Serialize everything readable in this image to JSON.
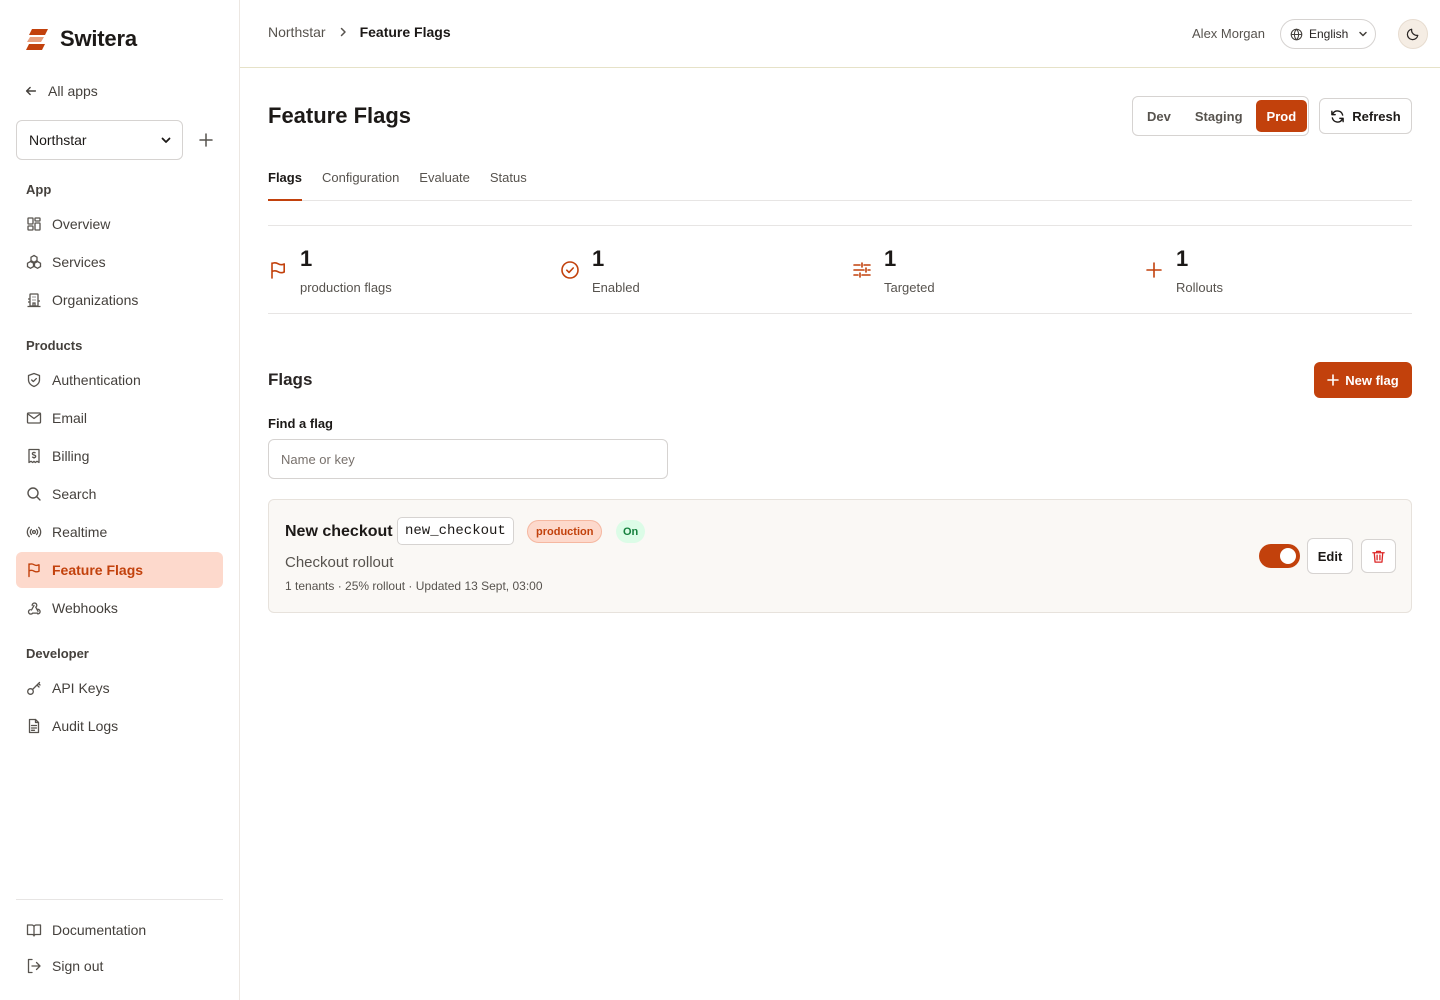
{
  "brand": {
    "name": "Switera"
  },
  "sidebar": {
    "back_label": "All apps",
    "app_select": {
      "value": "Northstar"
    },
    "sections": {
      "app": "App",
      "products": "Products",
      "developer": "Developer"
    },
    "items": {
      "overview": "Overview",
      "services": "Services",
      "organizations": "Organizations",
      "authentication": "Authentication",
      "email": "Email",
      "billing": "Billing",
      "search": "Search",
      "realtime": "Realtime",
      "feature_flags": "Feature Flags",
      "webhooks": "Webhooks",
      "api_keys": "API Keys",
      "audit_logs": "Audit Logs",
      "documentation": "Documentation",
      "sign_out": "Sign out"
    },
    "active_item": "Feature Flags"
  },
  "topbar": {
    "breadcrumb": [
      "Northstar",
      "Feature Flags"
    ],
    "user_name": "Alex Morgan",
    "language": "English"
  },
  "page": {
    "title": "Feature Flags",
    "environments": [
      "Dev",
      "Staging",
      "Prod"
    ],
    "active_environment": "Prod",
    "refresh_label": "Refresh",
    "tabs": [
      "Flags",
      "Configuration",
      "Evaluate",
      "Status"
    ],
    "active_tab": "Flags"
  },
  "stats": [
    {
      "value": "1",
      "label": "production flags",
      "icon": "flag-icon"
    },
    {
      "value": "1",
      "label": "Enabled",
      "icon": "check-circle-icon"
    },
    {
      "value": "1",
      "label": "Targeted",
      "icon": "sliders-icon"
    },
    {
      "value": "1",
      "label": "Rollouts",
      "icon": "plus-icon"
    }
  ],
  "flags_section": {
    "heading": "Flags",
    "new_button": "New flag",
    "search_label": "Find a flag",
    "search_placeholder": "Name or key",
    "search_value": ""
  },
  "flags": [
    {
      "name": "New checkout",
      "key": "new_checkout",
      "environment_badge": "production",
      "status_badge": "On",
      "description": "Checkout rollout",
      "meta": "1 tenants · 25% rollout · Updated 13 Sept, 03:00",
      "enabled": true,
      "edit_label": "Edit"
    }
  ],
  "colors": {
    "accent": "#c2410c",
    "accent_soft": "#fdd9cc",
    "on_badge_bg": "#dcfce7",
    "on_badge_text": "#15803d"
  }
}
